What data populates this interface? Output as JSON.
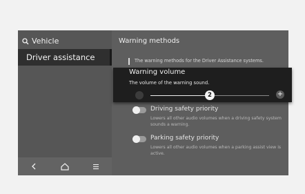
{
  "sidebar": {
    "header_label": "Vehicle",
    "header_icon": "search-icon",
    "selected_item": "Driver assistance"
  },
  "navbar": {
    "back_glyph": "<",
    "home_icon": "home-icon",
    "menu_glyph": "≡"
  },
  "content": {
    "title": "Warning methods",
    "description": "The warning methods for the Driver Assistance systems.",
    "options": [
      {
        "title": "Driving safety priority",
        "description": "Lowers all other audio volumes when a driving safety system sounds a warning.",
        "enabled": false
      },
      {
        "title": "Parking safety priority",
        "description": "Lowers all other audio volumes when a parking assist view is active.",
        "enabled": false
      }
    ]
  },
  "popup": {
    "title": "Warning volume",
    "description": "The volume of the warning sound.",
    "value_label": "2",
    "slider_fraction": 0.5,
    "plus_label": "+"
  },
  "colors": {
    "screen_bg": "#5e5e5e",
    "sidebar_selected": "#2f2f2f",
    "popup_bg": "#1e1e1e"
  }
}
